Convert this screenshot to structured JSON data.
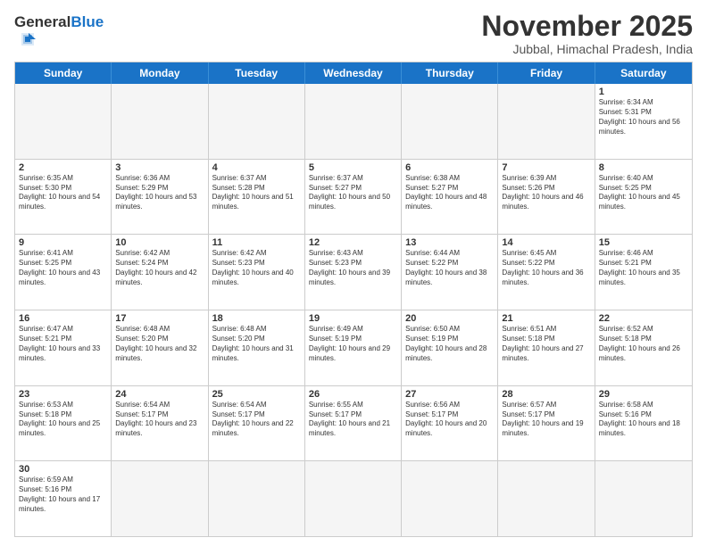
{
  "logo": {
    "general": "General",
    "blue": "Blue"
  },
  "header": {
    "title": "November 2025",
    "subtitle": "Jubbal, Himachal Pradesh, India"
  },
  "weekdays": [
    "Sunday",
    "Monday",
    "Tuesday",
    "Wednesday",
    "Thursday",
    "Friday",
    "Saturday"
  ],
  "weeks": [
    [
      {
        "day": "",
        "text": ""
      },
      {
        "day": "",
        "text": ""
      },
      {
        "day": "",
        "text": ""
      },
      {
        "day": "",
        "text": ""
      },
      {
        "day": "",
        "text": ""
      },
      {
        "day": "",
        "text": ""
      },
      {
        "day": "1",
        "text": "Sunrise: 6:34 AM\nSunset: 5:31 PM\nDaylight: 10 hours and 56 minutes."
      }
    ],
    [
      {
        "day": "2",
        "text": "Sunrise: 6:35 AM\nSunset: 5:30 PM\nDaylight: 10 hours and 54 minutes."
      },
      {
        "day": "3",
        "text": "Sunrise: 6:36 AM\nSunset: 5:29 PM\nDaylight: 10 hours and 53 minutes."
      },
      {
        "day": "4",
        "text": "Sunrise: 6:37 AM\nSunset: 5:28 PM\nDaylight: 10 hours and 51 minutes."
      },
      {
        "day": "5",
        "text": "Sunrise: 6:37 AM\nSunset: 5:27 PM\nDaylight: 10 hours and 50 minutes."
      },
      {
        "day": "6",
        "text": "Sunrise: 6:38 AM\nSunset: 5:27 PM\nDaylight: 10 hours and 48 minutes."
      },
      {
        "day": "7",
        "text": "Sunrise: 6:39 AM\nSunset: 5:26 PM\nDaylight: 10 hours and 46 minutes."
      },
      {
        "day": "8",
        "text": "Sunrise: 6:40 AM\nSunset: 5:25 PM\nDaylight: 10 hours and 45 minutes."
      }
    ],
    [
      {
        "day": "9",
        "text": "Sunrise: 6:41 AM\nSunset: 5:25 PM\nDaylight: 10 hours and 43 minutes."
      },
      {
        "day": "10",
        "text": "Sunrise: 6:42 AM\nSunset: 5:24 PM\nDaylight: 10 hours and 42 minutes."
      },
      {
        "day": "11",
        "text": "Sunrise: 6:42 AM\nSunset: 5:23 PM\nDaylight: 10 hours and 40 minutes."
      },
      {
        "day": "12",
        "text": "Sunrise: 6:43 AM\nSunset: 5:23 PM\nDaylight: 10 hours and 39 minutes."
      },
      {
        "day": "13",
        "text": "Sunrise: 6:44 AM\nSunset: 5:22 PM\nDaylight: 10 hours and 38 minutes."
      },
      {
        "day": "14",
        "text": "Sunrise: 6:45 AM\nSunset: 5:22 PM\nDaylight: 10 hours and 36 minutes."
      },
      {
        "day": "15",
        "text": "Sunrise: 6:46 AM\nSunset: 5:21 PM\nDaylight: 10 hours and 35 minutes."
      }
    ],
    [
      {
        "day": "16",
        "text": "Sunrise: 6:47 AM\nSunset: 5:21 PM\nDaylight: 10 hours and 33 minutes."
      },
      {
        "day": "17",
        "text": "Sunrise: 6:48 AM\nSunset: 5:20 PM\nDaylight: 10 hours and 32 minutes."
      },
      {
        "day": "18",
        "text": "Sunrise: 6:48 AM\nSunset: 5:20 PM\nDaylight: 10 hours and 31 minutes."
      },
      {
        "day": "19",
        "text": "Sunrise: 6:49 AM\nSunset: 5:19 PM\nDaylight: 10 hours and 29 minutes."
      },
      {
        "day": "20",
        "text": "Sunrise: 6:50 AM\nSunset: 5:19 PM\nDaylight: 10 hours and 28 minutes."
      },
      {
        "day": "21",
        "text": "Sunrise: 6:51 AM\nSunset: 5:18 PM\nDaylight: 10 hours and 27 minutes."
      },
      {
        "day": "22",
        "text": "Sunrise: 6:52 AM\nSunset: 5:18 PM\nDaylight: 10 hours and 26 minutes."
      }
    ],
    [
      {
        "day": "23",
        "text": "Sunrise: 6:53 AM\nSunset: 5:18 PM\nDaylight: 10 hours and 25 minutes."
      },
      {
        "day": "24",
        "text": "Sunrise: 6:54 AM\nSunset: 5:17 PM\nDaylight: 10 hours and 23 minutes."
      },
      {
        "day": "25",
        "text": "Sunrise: 6:54 AM\nSunset: 5:17 PM\nDaylight: 10 hours and 22 minutes."
      },
      {
        "day": "26",
        "text": "Sunrise: 6:55 AM\nSunset: 5:17 PM\nDaylight: 10 hours and 21 minutes."
      },
      {
        "day": "27",
        "text": "Sunrise: 6:56 AM\nSunset: 5:17 PM\nDaylight: 10 hours and 20 minutes."
      },
      {
        "day": "28",
        "text": "Sunrise: 6:57 AM\nSunset: 5:17 PM\nDaylight: 10 hours and 19 minutes."
      },
      {
        "day": "29",
        "text": "Sunrise: 6:58 AM\nSunset: 5:16 PM\nDaylight: 10 hours and 18 minutes."
      }
    ],
    [
      {
        "day": "30",
        "text": "Sunrise: 6:59 AM\nSunset: 5:16 PM\nDaylight: 10 hours and 17 minutes."
      },
      {
        "day": "",
        "text": ""
      },
      {
        "day": "",
        "text": ""
      },
      {
        "day": "",
        "text": ""
      },
      {
        "day": "",
        "text": ""
      },
      {
        "day": "",
        "text": ""
      },
      {
        "day": "",
        "text": ""
      }
    ]
  ]
}
